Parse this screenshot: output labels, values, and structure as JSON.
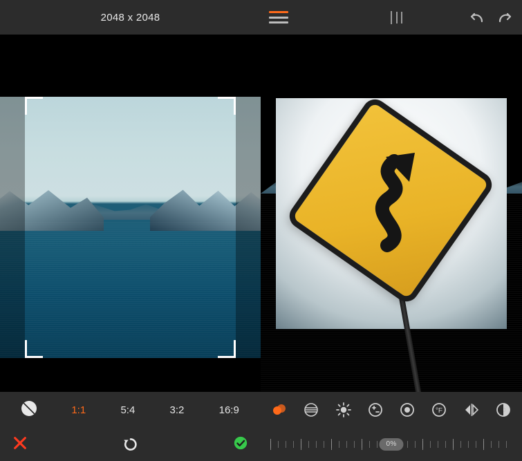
{
  "left_pane": {
    "title": "2048 x 2048",
    "ratios": [
      "1:1",
      "5:4",
      "3:2",
      "16:9"
    ],
    "active_ratio_index": 0,
    "contrast_icon": "contrast-icon",
    "cancel_icon": "close-icon",
    "reset_icon": "undo-circular-icon",
    "confirm_icon": "checkmark-circle-icon",
    "cancel_color": "#ff3a1f",
    "confirm_color": "#37c94b"
  },
  "right_pane": {
    "menu_icon": "hamburger-icon",
    "grid_icon": "grid-icon",
    "undo_icon": "undo-icon",
    "redo_icon": "redo-icon",
    "filters": [
      {
        "name": "filter-hue-icon",
        "active": true
      },
      {
        "name": "filter-rows-icon",
        "active": false
      },
      {
        "name": "filter-brightness-icon",
        "active": false
      },
      {
        "name": "filter-exposure-icon",
        "active": false
      },
      {
        "name": "filter-vignette-icon",
        "active": false
      },
      {
        "name": "filter-temperature-icon",
        "active": false
      },
      {
        "name": "filter-flip-icon",
        "active": false
      },
      {
        "name": "filter-invert-icon",
        "active": false
      }
    ],
    "slider_value_label": "0%",
    "accent_color": "#ff6a1a"
  }
}
